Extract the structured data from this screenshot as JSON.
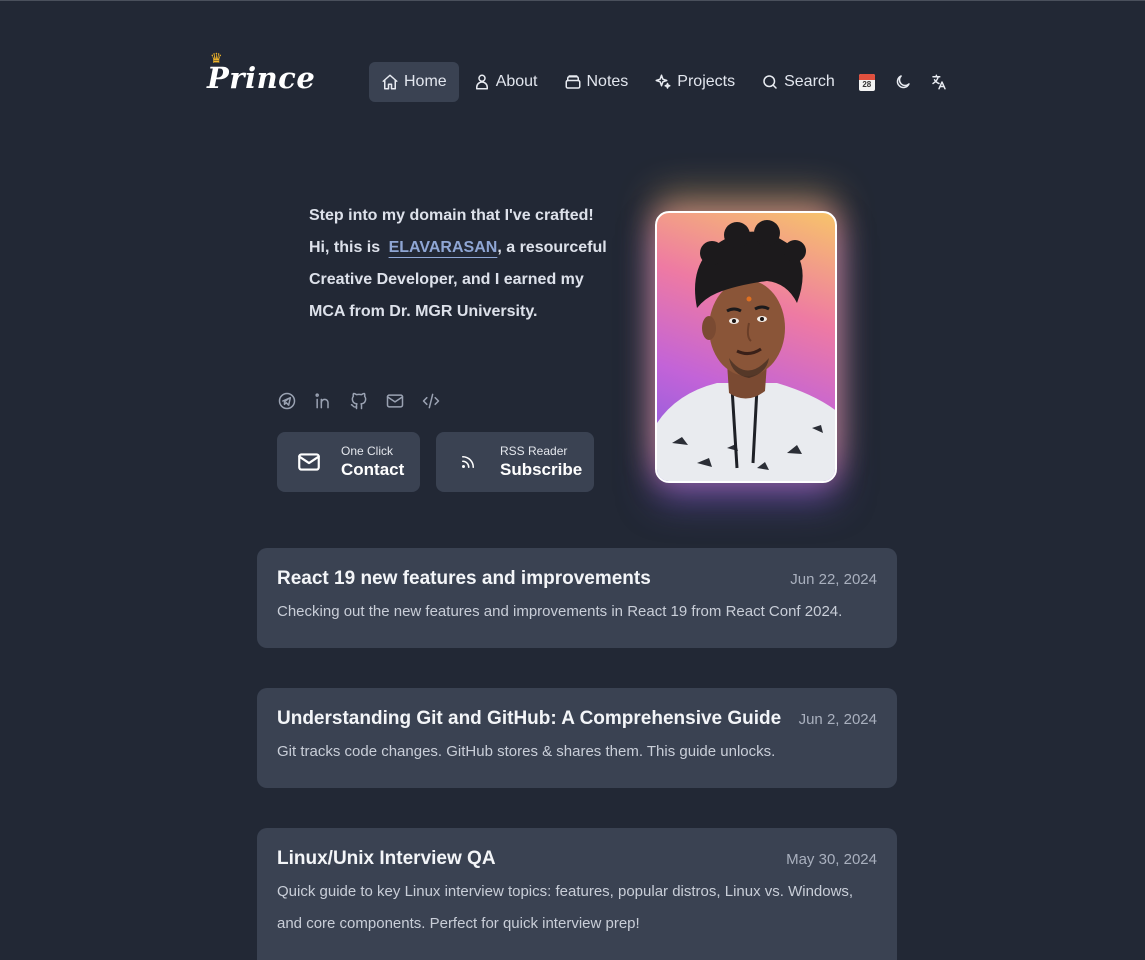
{
  "logo": {
    "text": "Prince",
    "crown": "♛"
  },
  "nav": {
    "items": [
      {
        "label": "Home",
        "icon": "home-icon",
        "active": true
      },
      {
        "label": "About",
        "icon": "user-icon"
      },
      {
        "label": "Notes",
        "icon": "notes-icon"
      },
      {
        "label": "Projects",
        "icon": "sparkles-icon"
      },
      {
        "label": "Search",
        "icon": "search-icon"
      }
    ],
    "calendar_day": "28"
  },
  "intro": {
    "line1": "Step into my domain that I've crafted!",
    "hi_prefix": "Hi, this is",
    "name": "ELAVARASAN",
    "rest": ", a resourceful Creative Developer, and I earned my MCA from Dr. MGR University."
  },
  "socials": [
    "telegram-icon",
    "linkedin-icon",
    "github-icon",
    "mail-icon",
    "code-icon"
  ],
  "cta": {
    "contact": {
      "small": "One Click",
      "big": "Contact"
    },
    "subscribe": {
      "small": "RSS Reader",
      "big": "Subscribe"
    }
  },
  "posts": [
    {
      "title": "React 19 new features and improvements",
      "date": "Jun 22, 2024",
      "desc": "Checking out the new features and improvements in React 19 from React Conf 2024."
    },
    {
      "title": "Understanding Git and GitHub: A Comprehensive Guide",
      "date": "Jun 2, 2024",
      "desc": "Git tracks code changes. GitHub stores & shares them. This guide unlocks."
    },
    {
      "title": "Linux/Unix Interview QA",
      "date": "May 30, 2024",
      "desc": "Quick guide to key Linux interview topics: features, popular distros, Linux vs. Windows, and core components. Perfect for quick interview prep!"
    }
  ],
  "colors": {
    "background": "#222835",
    "card": "#3a4252",
    "accent_name": "#8fa6d4"
  }
}
